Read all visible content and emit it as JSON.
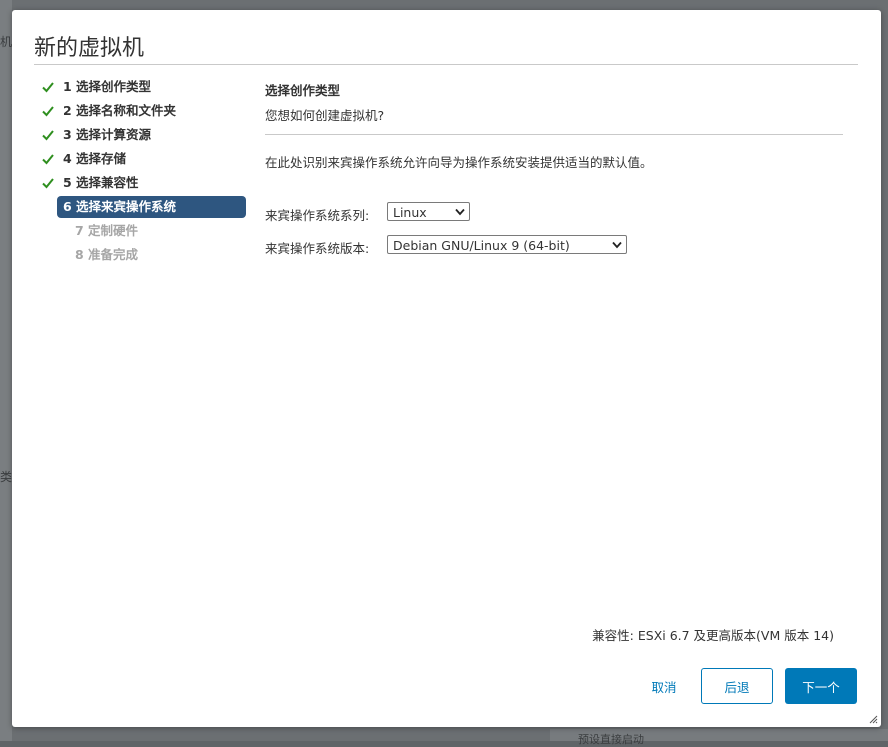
{
  "background": {
    "fragments": [
      "机",
      "类"
    ],
    "bottom_text": "预设直接启动"
  },
  "dialog": {
    "title": "新的虚拟机",
    "steps": [
      {
        "label": "1 选择创作类型",
        "state": "done"
      },
      {
        "label": "2 选择名称和文件夹",
        "state": "done"
      },
      {
        "label": "3 选择计算资源",
        "state": "done"
      },
      {
        "label": "4 选择存储",
        "state": "done"
      },
      {
        "label": "5 选择兼容性",
        "state": "done"
      },
      {
        "label": "6 选择来宾操作系统",
        "state": "active"
      },
      {
        "label": "7 定制硬件",
        "state": "disabled"
      },
      {
        "label": "8 准备完成",
        "state": "disabled"
      }
    ],
    "content": {
      "heading": "选择创作类型",
      "subheading": "您想如何创建虚拟机?",
      "description": "在此处识别来宾操作系统允许向导为操作系统安装提供适当的默认值。",
      "family_label": "来宾操作系统系列:",
      "family_value": "Linux",
      "version_label": "来宾操作系统版本:",
      "version_value": "Debian GNU/Linux 9 (64-bit)"
    },
    "compatibility": "兼容性: ESXi 6.7 及更高版本(VM 版本 14)",
    "buttons": {
      "cancel": "取消",
      "back": "后退",
      "next": "下一个"
    }
  },
  "colors": {
    "accent": "#0079b8",
    "active_step": "#2e5680",
    "check": "#2f8f1f"
  },
  "icons": {
    "done_step": "check-icon",
    "select": "chevron-down-icon",
    "resize": "resize-handle-icon"
  }
}
